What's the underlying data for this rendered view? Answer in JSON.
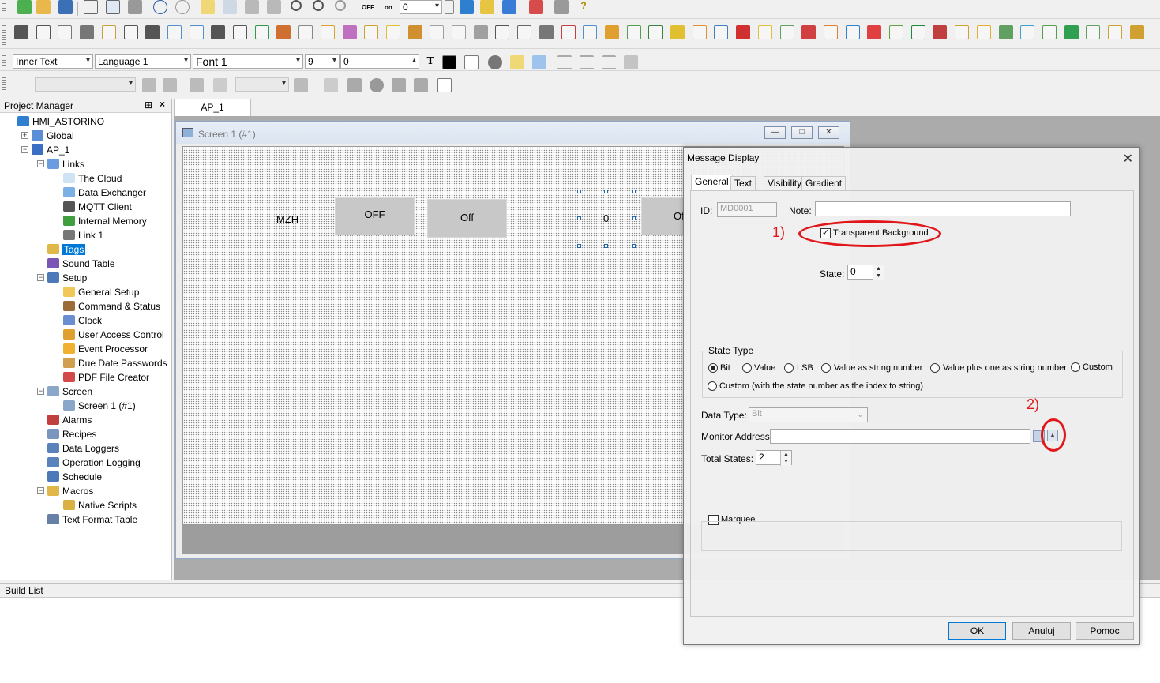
{
  "toolbar3": {
    "style_combo": "Inner Text",
    "language_combo": "Language 1",
    "font_combo": "Font 1",
    "size_combo": "9",
    "value_field": "0"
  },
  "toolbar1": {
    "state_combo": "0",
    "off_label": "OFF",
    "on_label": "on"
  },
  "project_manager": {
    "title": "Project Manager",
    "items": [
      {
        "label": "HMI_ASTORINO"
      },
      {
        "label": "Global"
      },
      {
        "label": "AP_1"
      },
      {
        "label": "Links"
      },
      {
        "label": "The Cloud"
      },
      {
        "label": "Data Exchanger"
      },
      {
        "label": "MQTT Client"
      },
      {
        "label": "Internal Memory"
      },
      {
        "label": "Link 1"
      },
      {
        "label": "Tags"
      },
      {
        "label": "Sound Table"
      },
      {
        "label": "Setup"
      },
      {
        "label": "General Setup"
      },
      {
        "label": "Command & Status"
      },
      {
        "label": "Clock"
      },
      {
        "label": "User Access Control"
      },
      {
        "label": "Event Processor"
      },
      {
        "label": "Due Date Passwords"
      },
      {
        "label": "PDF File Creator"
      },
      {
        "label": "Screen"
      },
      {
        "label": "Screen 1 (#1)"
      },
      {
        "label": "Alarms"
      },
      {
        "label": "Recipes"
      },
      {
        "label": "Data Loggers"
      },
      {
        "label": "Operation Logging"
      },
      {
        "label": "Schedule"
      },
      {
        "label": "Macros"
      },
      {
        "label": "Native Scripts"
      },
      {
        "label": "Text Format Table"
      }
    ]
  },
  "editor": {
    "tab": "AP_1",
    "screen_title": "Screen 1 (#1)",
    "objects": {
      "mzh_label": "MZH",
      "btn_off_upper": "OFF",
      "btn_off_mixed": "Off",
      "number_display": "0",
      "btn_partial": "Of"
    }
  },
  "build_list": {
    "title": "Build List"
  },
  "dialog": {
    "title": "Message Display",
    "tabs": [
      "General",
      "Text",
      "Visibility",
      "Gradient"
    ],
    "id_label": "ID:",
    "id_value": "MD0001",
    "note_label": "Note:",
    "note_value": "",
    "transparent_bg_label": "Transparent Background",
    "transparent_bg_checked": true,
    "state_label": "State:",
    "state_value": "0",
    "state_type": {
      "title": "State Type",
      "options": [
        "Bit",
        "Value",
        "LSB",
        "Value as string number",
        "Value plus one as string number",
        "Custom"
      ],
      "custom_index_option": "Custom (with the state number as the index to string)",
      "selected": "Bit"
    },
    "data_type_label": "Data Type:",
    "data_type_value": "Bit",
    "monitor_address_label": "Monitor Address:",
    "monitor_address_value": "",
    "total_states_label": "Total States:",
    "total_states_value": "2",
    "marquee_label": "Marquee",
    "buttons": {
      "ok": "OK",
      "cancel": "Anuluj",
      "help": "Pomoc"
    }
  },
  "annotations": {
    "one": "1)",
    "two": "2)",
    "color": "#e0161a"
  }
}
